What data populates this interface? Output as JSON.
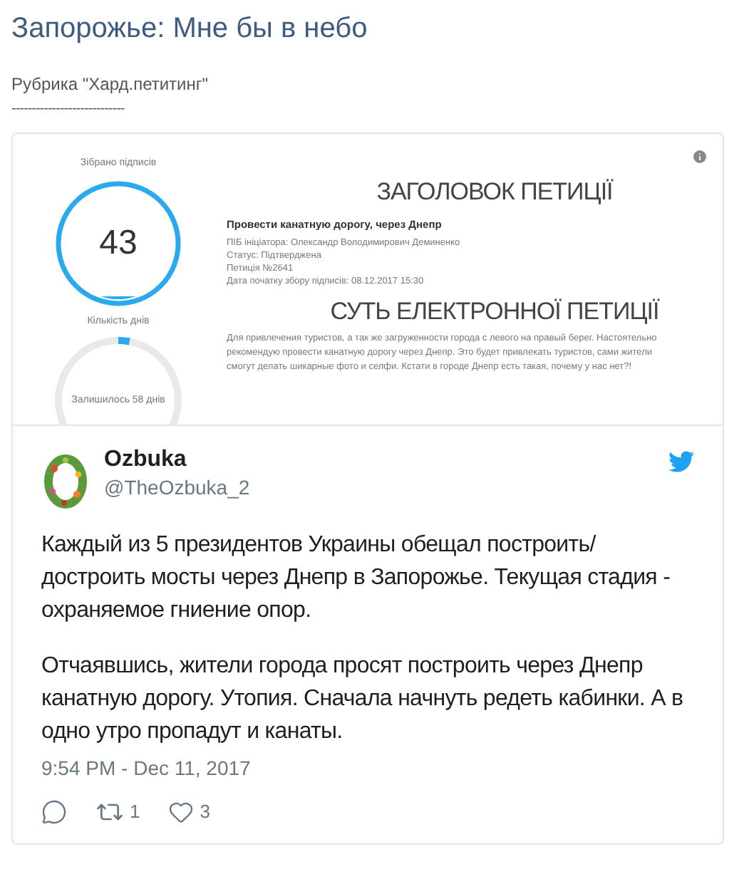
{
  "title": "Запорожье: Мне бы в небо",
  "rubric": "Рубрика \"Хард.петитинг\"",
  "separator": "----------------------------",
  "petition": {
    "gauges": [
      {
        "kind": "fill",
        "label": "Зібрано підписів",
        "value": "43"
      },
      {
        "kind": "arc",
        "label": "Кількість днів",
        "value": "Залишилось 58 днів"
      }
    ],
    "heading": "ЗАГОЛОВОК ПЕТИЦІЇ",
    "name": "Провести канатную дорогу, через Днепр",
    "details": [
      "ПІБ ініціатора: Олександр Володимирович Деминенко",
      "Статус: Підтверджена",
      "Петиція №2641",
      "Дата початку збору підписів: 08.12.2017 15:30"
    ],
    "summary_heading": "СУТЬ ЕЛЕКТРОННОЇ ПЕТИЦІЇ",
    "summary": "Для привлечения туристов, а так же загруженности города с левого на правый берег. Настоятельно рекомендую провести канатную дорогу через Днепр. Это будет привлекать туристов, сами жители смогут делать шикарные фото и селфи. Кстати в городе Днепр есть такая, почему у нас нет?!"
  },
  "tweet": {
    "author": "Ozbuka",
    "handle": "@TheOzbuka_2",
    "paragraphs": [
      "Каждый из 5 президентов Украины обещал построить/ достроить мосты через Днепр в Запорожье. Текущая стадия - охраняемое гниение опор.",
      "Отчаявшись, жители города просят построить через Днепр канатную дорогу. Утопия. Сначала начнуть редеть кабинки. А в одно утро пропадут и канаты."
    ],
    "time": "9:54 PM - Dec 11, 2017",
    "actions": [
      {
        "kind": "reply"
      },
      {
        "kind": "retweet",
        "count": "1"
      },
      {
        "kind": "like",
        "count": "3"
      }
    ]
  }
}
